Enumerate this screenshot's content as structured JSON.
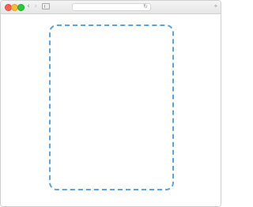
{
  "toolbar": {
    "traffic_lights": [
      {
        "name": "close",
        "color": "#ff5f57"
      },
      {
        "name": "minimize",
        "color": "#febc2e"
      },
      {
        "name": "maximize",
        "color": "#28c840"
      }
    ],
    "back_icon": "chevron-left-icon",
    "forward_icon": "chevron-right-icon",
    "sidebar_icon": "sidebar-icon",
    "address_value": "",
    "reload_icon": "reload-icon",
    "new_tab_icon": "plus-icon"
  },
  "content": {
    "dropzone_border_color": "#5aa4e0"
  }
}
